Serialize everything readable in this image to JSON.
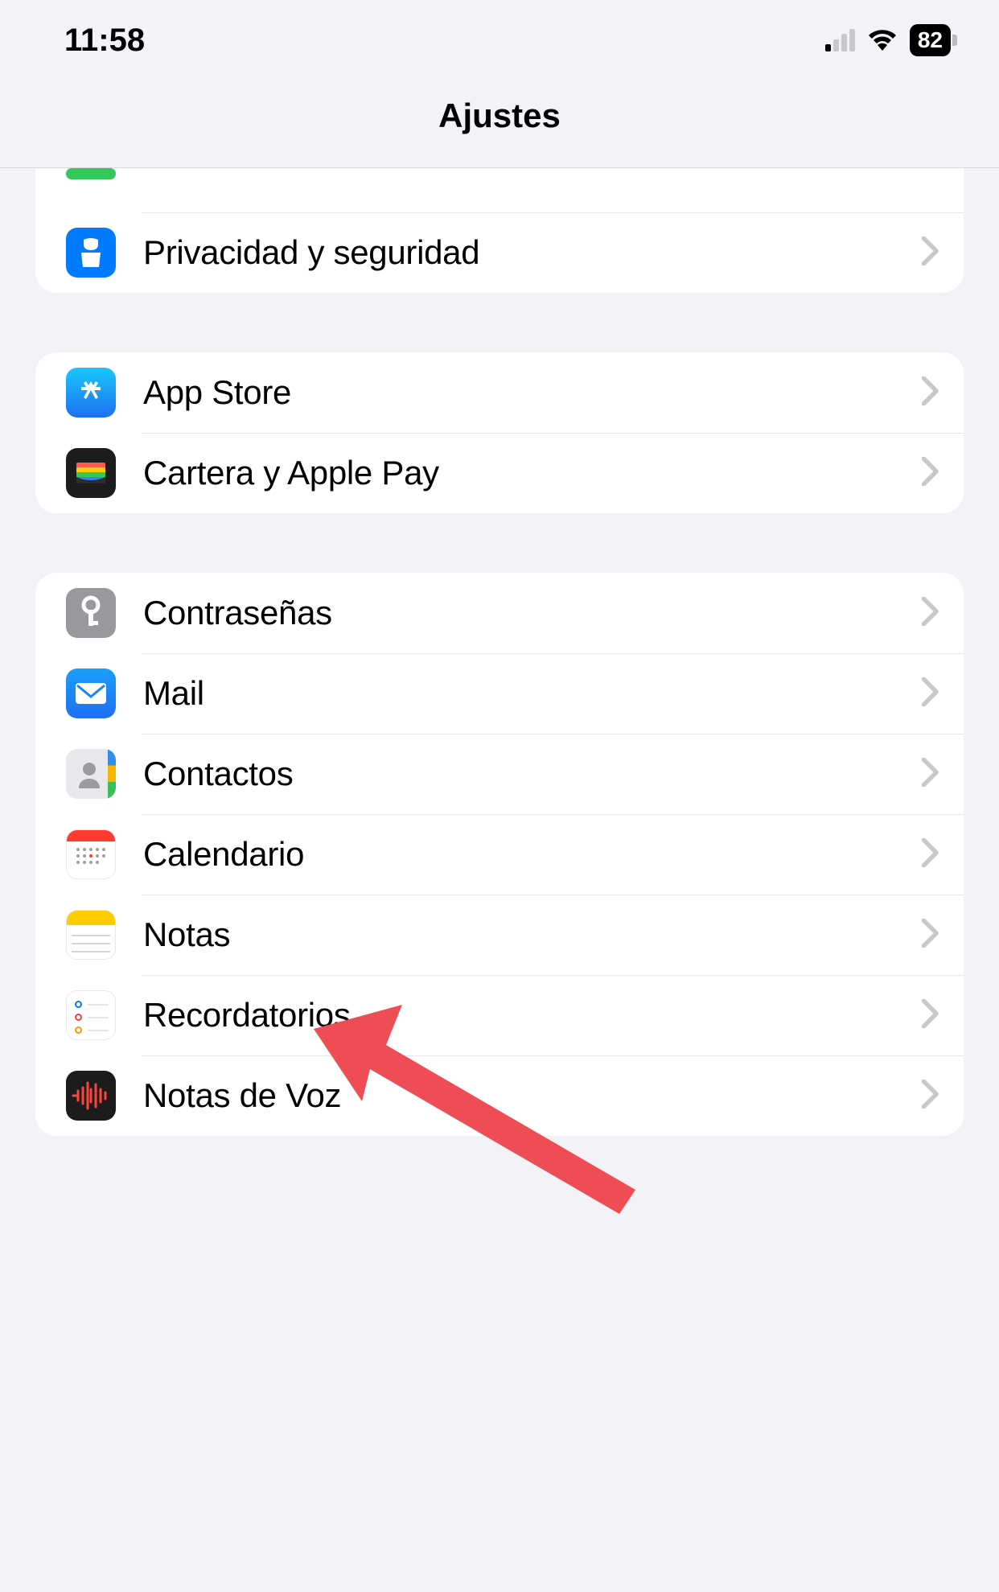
{
  "status": {
    "time": "11:58",
    "battery": "82"
  },
  "header": {
    "title": "Ajustes"
  },
  "groups": [
    {
      "rows": [
        {
          "id": "battery-partial",
          "label": "",
          "partial": true,
          "icon": "battery"
        },
        {
          "id": "privacy",
          "label": "Privacidad y seguridad",
          "icon": "privacy"
        }
      ]
    },
    {
      "rows": [
        {
          "id": "appstore",
          "label": "App Store",
          "icon": "appstore"
        },
        {
          "id": "wallet",
          "label": "Cartera y Apple Pay",
          "icon": "wallet"
        }
      ]
    },
    {
      "rows": [
        {
          "id": "passwords",
          "label": "Contraseñas",
          "icon": "passwords"
        },
        {
          "id": "mail",
          "label": "Mail",
          "icon": "mail"
        },
        {
          "id": "contacts",
          "label": "Contactos",
          "icon": "contacts"
        },
        {
          "id": "calendar",
          "label": "Calendario",
          "icon": "calendar"
        },
        {
          "id": "notes",
          "label": "Notas",
          "icon": "notes"
        },
        {
          "id": "reminders",
          "label": "Recordatorios",
          "icon": "reminders"
        },
        {
          "id": "voicememos",
          "label": "Notas de Voz",
          "icon": "voice"
        }
      ]
    }
  ]
}
